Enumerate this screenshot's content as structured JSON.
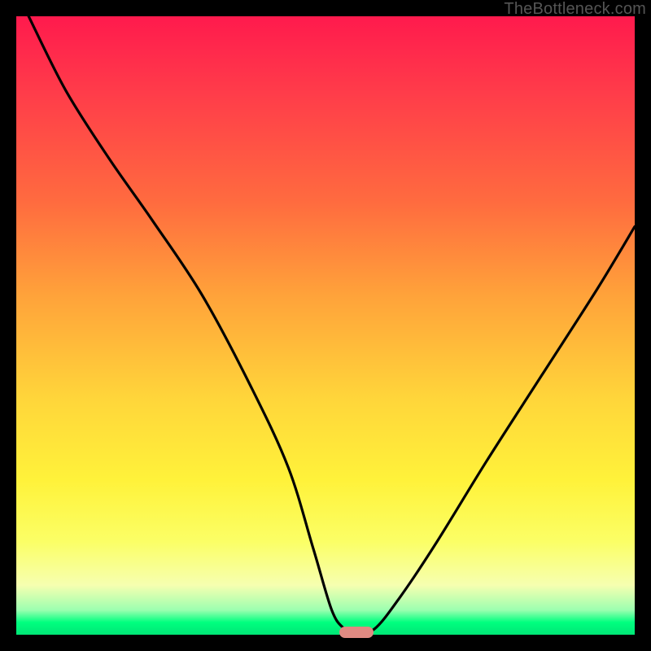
{
  "watermark": "TheBottleneck.com",
  "colors": {
    "frame": "#000000",
    "gradient_top": "#ff1a4d",
    "gradient_mid1": "#ffa23a",
    "gradient_mid2": "#fff23a",
    "gradient_bottom": "#00e676",
    "curve": "#000000",
    "marker": "#e08a82"
  },
  "chart_data": {
    "type": "line",
    "title": "",
    "xlabel": "",
    "ylabel": "",
    "xlim": [
      0,
      100
    ],
    "ylim": [
      0,
      100
    ],
    "series": [
      {
        "name": "bottleneck-curve",
        "x": [
          2,
          8,
          15,
          22,
          30,
          38,
          44,
          48,
          51,
          53,
          55,
          58,
          62,
          68,
          76,
          85,
          94,
          100
        ],
        "values": [
          100,
          88,
          77,
          67,
          55,
          40,
          27,
          14,
          4,
          1,
          0,
          1,
          6,
          15,
          28,
          42,
          56,
          66
        ]
      }
    ],
    "annotations": [
      {
        "name": "min-marker",
        "x": 55,
        "y": 0,
        "shape": "pill",
        "color": "#e08a82"
      }
    ]
  }
}
